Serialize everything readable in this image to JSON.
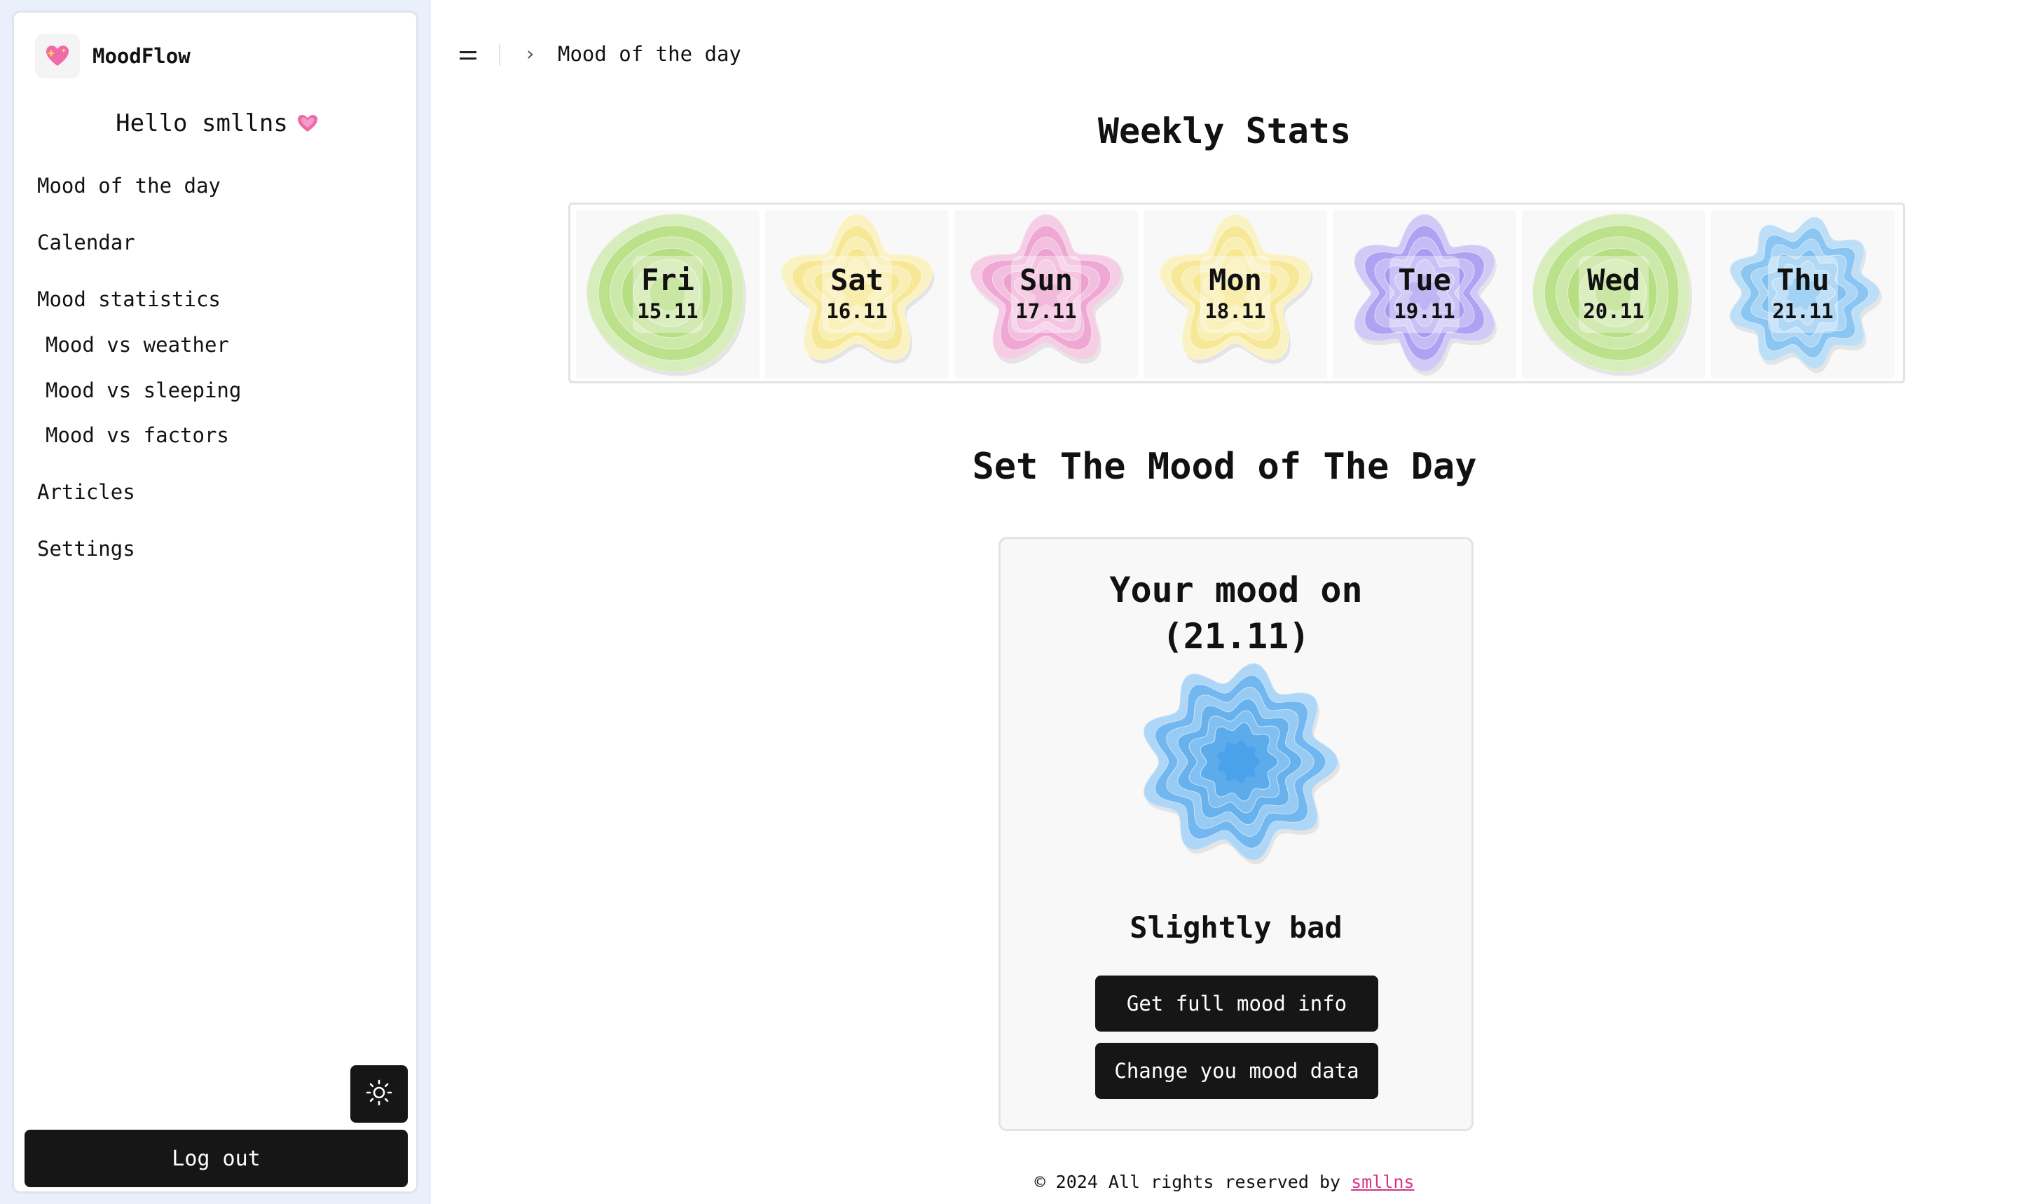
{
  "app": {
    "name": "MoodFlow",
    "logo_icon": "sparkling-heart-icon"
  },
  "sidebar": {
    "greeting": "Hello smllns",
    "greeting_icon": "pink-heart-icon",
    "items": [
      {
        "label": "Mood of the day"
      },
      {
        "label": "Calendar"
      },
      {
        "label": "Mood statistics"
      },
      {
        "label": "Mood vs weather"
      },
      {
        "label": "Mood vs sleeping"
      },
      {
        "label": "Mood vs factors"
      },
      {
        "label": "Articles"
      },
      {
        "label": "Settings"
      }
    ],
    "theme_icon": "sun-icon",
    "logout_label": "Log out"
  },
  "header": {
    "menu_icon": "menu-icon",
    "breadcrumb": "Mood of the day"
  },
  "weekly": {
    "title": "Weekly Stats",
    "days": [
      {
        "day": "Fri",
        "date": "15.11",
        "mood_color": "#a8d86a",
        "shape": "circle"
      },
      {
        "day": "Sat",
        "date": "16.11",
        "mood_color": "#f5e27a",
        "shape": "flower5"
      },
      {
        "day": "Sun",
        "date": "17.11",
        "mood_color": "#e98fc6",
        "shape": "flower5"
      },
      {
        "day": "Mon",
        "date": "18.11",
        "mood_color": "#f5e27a",
        "shape": "flower5"
      },
      {
        "day": "Tue",
        "date": "19.11",
        "mood_color": "#9a88ee",
        "shape": "star"
      },
      {
        "day": "Wed",
        "date": "20.11",
        "mood_color": "#a8d86a",
        "shape": "circle"
      },
      {
        "day": "Thu",
        "date": "21.11",
        "mood_color": "#6ab6ee",
        "shape": "wavy"
      }
    ]
  },
  "mood_section": {
    "title": "Set The Mood of The Day",
    "heading_line1": "Your mood on",
    "heading_line2": "(21.11)",
    "mood_label": "Slightly bad",
    "mood_color": "#4aa3ea",
    "btn_info": "Get full mood info",
    "btn_change": "Change you mood data"
  },
  "footer": {
    "text": "© 2024 All rights reserved by",
    "link": "smllns"
  }
}
